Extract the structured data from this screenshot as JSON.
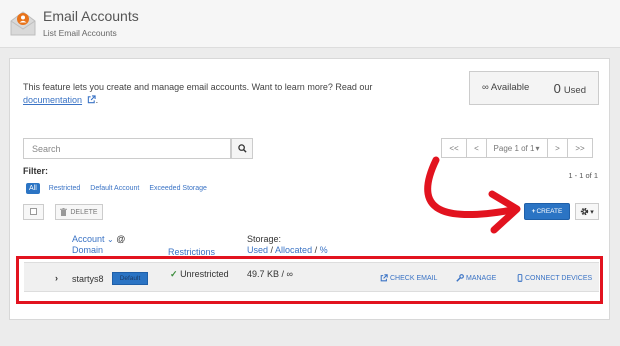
{
  "header": {
    "title": "Email Accounts",
    "subtitle": "List Email Accounts"
  },
  "intro": {
    "text": "This feature lets you create and manage email accounts. Want to learn more? Read our",
    "link": "documentation",
    "after": "."
  },
  "stats": {
    "available_symbol": "∞",
    "available_label": "Available",
    "used_count": "0",
    "used_label": "Used"
  },
  "search": {
    "placeholder": "Search"
  },
  "pager": {
    "first": "<<",
    "prev": "<",
    "page": "Page 1 of 1",
    "next": ">",
    "last": ">>"
  },
  "filter": {
    "label": "Filter:",
    "options": [
      "All",
      "Restricted",
      "Default Account",
      "Exceeded Storage"
    ],
    "active": "All",
    "count": "1 - 1 of 1"
  },
  "toolbar": {
    "delete_label": "DELETE",
    "create_label": "CREATE"
  },
  "columns": {
    "account": "Account",
    "at": "@",
    "domain": "Domain",
    "restrictions": "Restrictions",
    "storage": "Storage:",
    "used": "Used",
    "allocated": "Allocated",
    "percent": "%"
  },
  "row": {
    "account": "startys8",
    "badge": "Default",
    "restriction": "Unrestricted",
    "storage": "49.7 KB / ∞",
    "actions": {
      "check_email": "CHECK EMAIL",
      "manage": "MANAGE",
      "connect_devices": "CONNECT DEVICES"
    }
  },
  "colors": {
    "primary": "#2b74c4",
    "link": "#3a73c5",
    "annotation": "#e2131f",
    "success": "#3c8d3c"
  },
  "icons": [
    "envelope-user-icon",
    "external-link-icon",
    "search-icon",
    "trash-icon",
    "plus-icon",
    "gear-icon",
    "caret-down-icon",
    "chevron-right-icon",
    "check-icon",
    "external-link-icon",
    "wrench-icon",
    "mobile-icon",
    "arrow-annotation"
  ]
}
